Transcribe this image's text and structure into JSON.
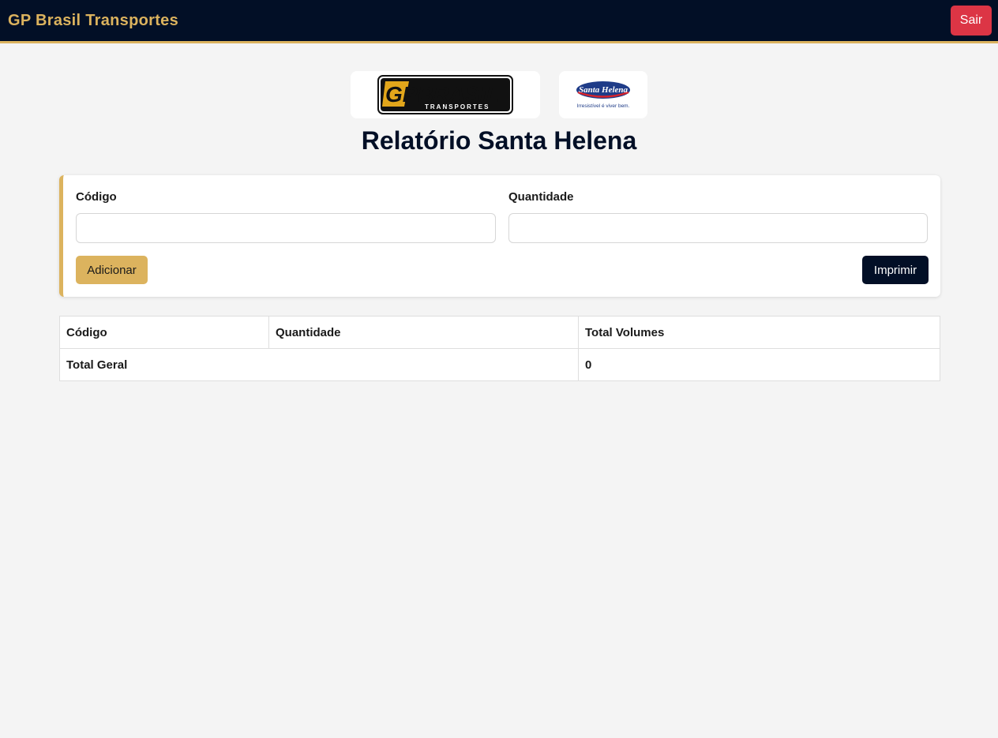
{
  "navbar": {
    "brand": "GP Brasil Transportes",
    "logout_label": "Sair"
  },
  "logos": {
    "gp_brasil": {
      "text": "GPBRASIL",
      "subtext": "TRANSPORTES"
    },
    "santa_helena": {
      "text": "Santa Helena",
      "tagline": "Irresistível é viver bem."
    }
  },
  "page": {
    "title": "Relatório Santa Helena"
  },
  "form": {
    "codigo_label": "Código",
    "codigo_value": "",
    "quantidade_label": "Quantidade",
    "quantidade_value": "",
    "add_label": "Adicionar",
    "print_label": "Imprimir"
  },
  "table": {
    "headers": [
      "Código",
      "Quantidade",
      "Total Volumes"
    ],
    "total_label": "Total Geral",
    "total_value": "0"
  },
  "colors": {
    "navy": "#020f26",
    "gold": "#dcb35e",
    "danger": "#dc3545",
    "background": "#f4f4f4"
  }
}
